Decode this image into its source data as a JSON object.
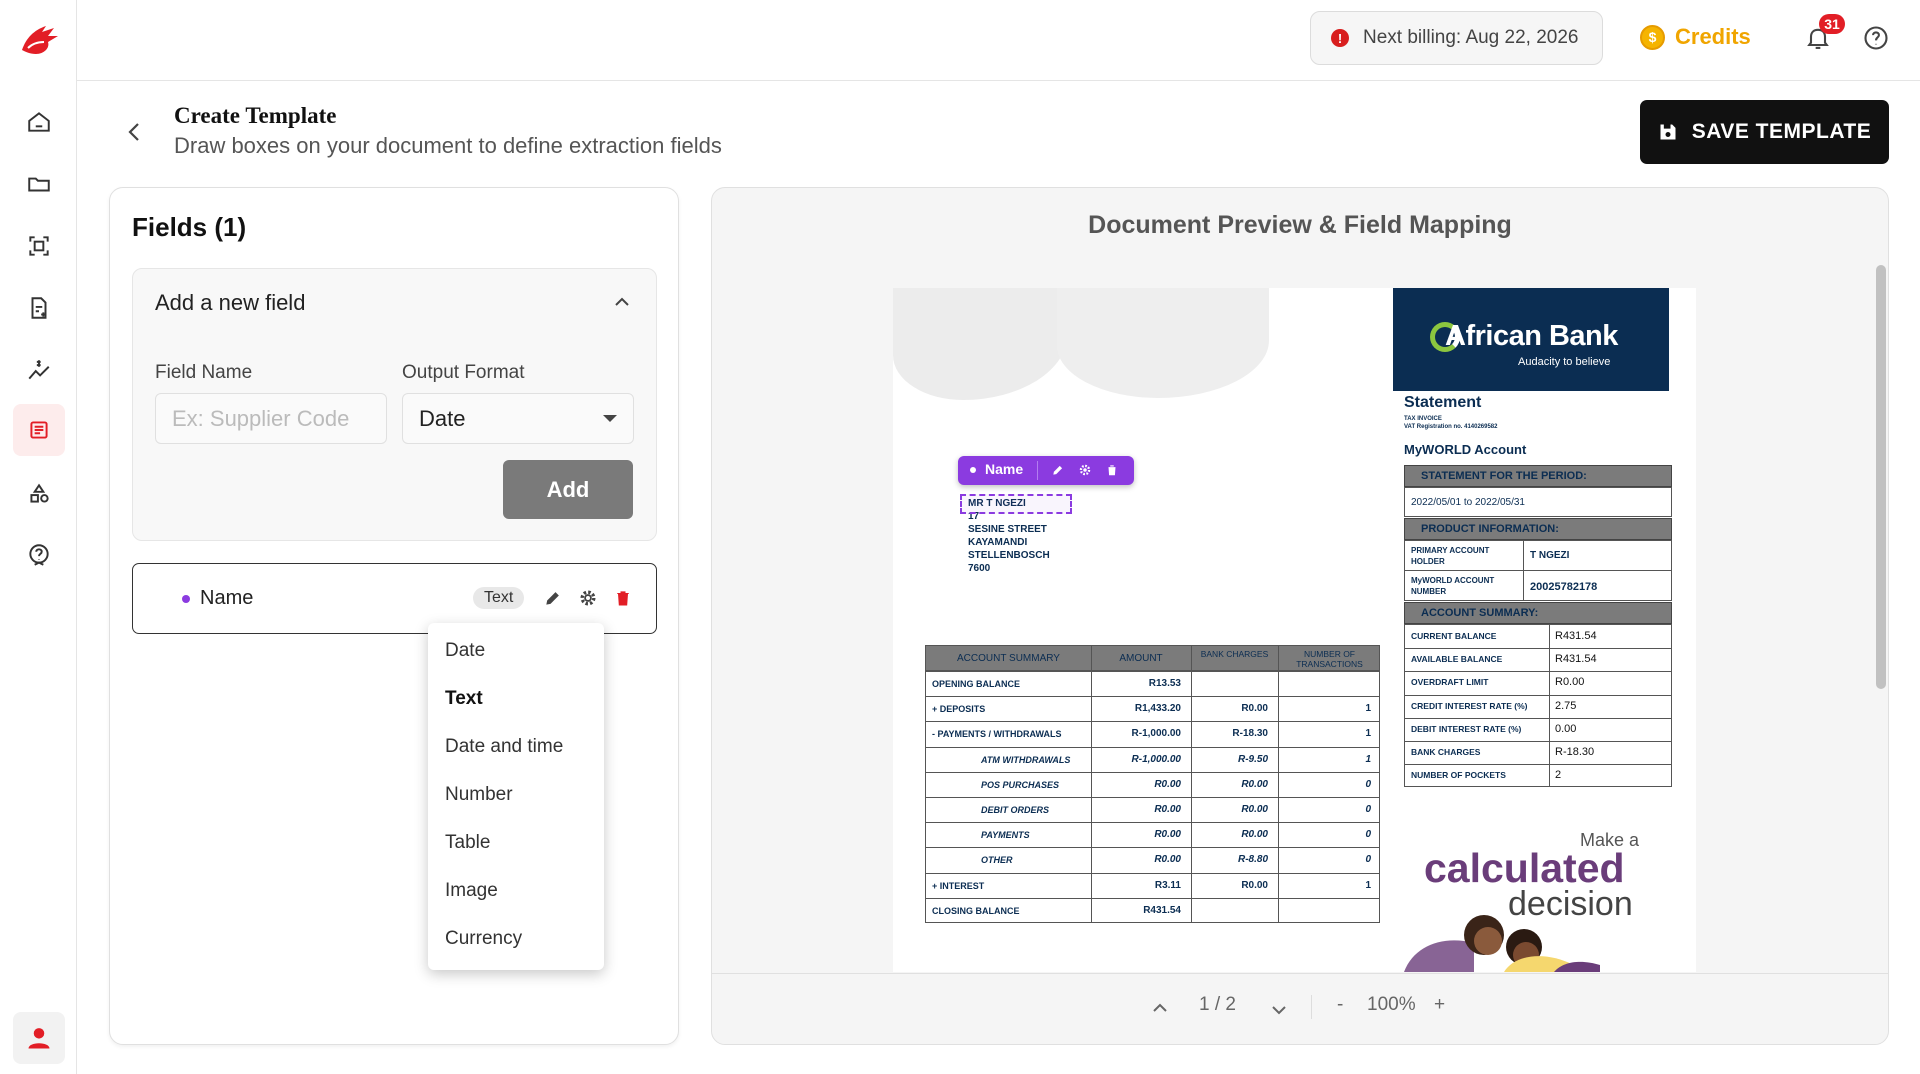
{
  "topbar": {
    "billing_label": "Next billing: Aug 22, 2026",
    "credits_label": "Credits",
    "credits_coin": "$",
    "notification_count": "31"
  },
  "sidebar": {
    "items": [
      "home-icon",
      "folder-icon",
      "scan-icon",
      "document-add-icon",
      "expense-icon",
      "template-icon",
      "shapes-icon",
      "help-icon"
    ],
    "active": "template-icon"
  },
  "header": {
    "title": "Create Template",
    "subtitle": "Draw boxes on your document to define extraction fields",
    "save_label": "SAVE TEMPLATE"
  },
  "fields_panel": {
    "title": "Fields (1)",
    "add_title": "Add a new field",
    "field_name_label": "Field Name",
    "field_name_placeholder": "Ex: Supplier Code",
    "output_format_label": "Output Format",
    "output_format_value": "Date",
    "add_button": "Add",
    "fields": [
      {
        "name": "Name",
        "type": "Text"
      }
    ]
  },
  "dropdown": {
    "options": [
      "Date",
      "Text",
      "Date and time",
      "Number",
      "Table",
      "Image",
      "Currency"
    ],
    "selected": "Text"
  },
  "preview": {
    "title": "Document Preview & Field Mapping",
    "page": "1 / 2",
    "zoom": "100%",
    "zoom_minus": "-",
    "zoom_plus": "+",
    "annotation_label": "Name"
  },
  "document": {
    "bank_name": "African Bank",
    "tagline": "Audacity to believe",
    "statement": "Statement",
    "tax_invoice": "TAX INVOICE",
    "vat_line": "VAT Registration no. 4140269582",
    "account_type": "MyWORLD Account",
    "address": [
      "MR T NGEZI",
      "17",
      "SESINE STREET",
      "KAYAMANDI",
      "STELLENBOSCH",
      "7600"
    ],
    "period_header": "STATEMENT FOR THE PERIOD:",
    "period": "2022/05/01 to 2022/05/31",
    "product_header": "PRODUCT INFORMATION:",
    "primary_holder_label": "PRIMARY ACCOUNT HOLDER",
    "primary_holder_value": "T NGEZI",
    "account_number_label": "MyWORLD ACCOUNT NUMBER",
    "account_number_value": "20025782178",
    "summary_header": "ACCOUNT SUMMARY:",
    "summary": [
      [
        "CURRENT BALANCE",
        "R431.54"
      ],
      [
        "AVAILABLE BALANCE",
        "R431.54"
      ],
      [
        "OVERDRAFT LIMIT",
        "R0.00"
      ],
      [
        "CREDIT INTEREST RATE (%)",
        "2.75"
      ],
      [
        "DEBIT INTEREST RATE (%)",
        "0.00"
      ],
      [
        "BANK CHARGES",
        "R-18.30"
      ],
      [
        "NUMBER OF POCKETS",
        "2"
      ]
    ],
    "table_headers": [
      "ACCOUNT SUMMARY",
      "AMOUNT",
      "BANK CHARGES",
      "NUMBER OF TRANSACTIONS"
    ],
    "table_rows": [
      [
        "OPENING BALANCE",
        "R13.53",
        "",
        ""
      ],
      [
        "+ DEPOSITS",
        "R1,433.20",
        "R0.00",
        "1"
      ],
      [
        "- PAYMENTS / WITHDRAWALS",
        "R-1,000.00",
        "R-18.30",
        "1"
      ],
      [
        "ATM WITHDRAWALS",
        "R-1,000.00",
        "R-9.50",
        "1"
      ],
      [
        "POS PURCHASES",
        "R0.00",
        "R0.00",
        "0"
      ],
      [
        "DEBIT ORDERS",
        "R0.00",
        "R0.00",
        "0"
      ],
      [
        "PAYMENTS",
        "R0.00",
        "R0.00",
        "0"
      ],
      [
        "OTHER",
        "R0.00",
        "R-8.80",
        "0"
      ],
      [
        "+ INTEREST",
        "R3.11",
        "R0.00",
        "1"
      ],
      [
        "CLOSING BALANCE",
        "R431.54",
        "",
        ""
      ]
    ],
    "promo": [
      "Make a",
      "calculated",
      "decision"
    ]
  },
  "colors": {
    "accent": "#e21e26",
    "purple": "#8b3be0",
    "navy": "#0b2d52",
    "credits": "#f0a500"
  }
}
